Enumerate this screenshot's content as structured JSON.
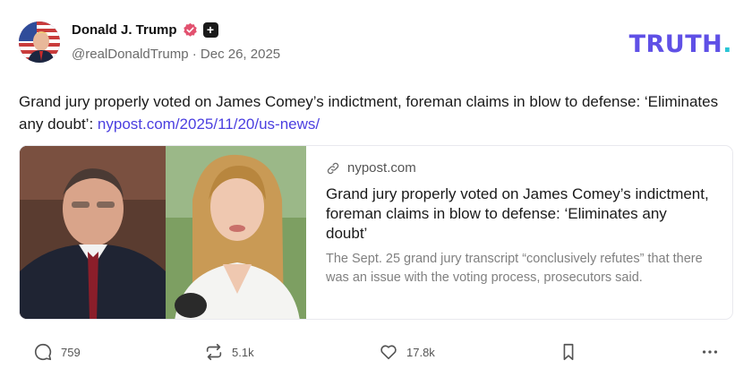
{
  "post": {
    "author": {
      "display_name": "Donald J. Trump",
      "handle": "@realDonaldTrump",
      "separator": "·",
      "date": "Dec 26, 2025",
      "verified_color": "#e2516f"
    },
    "logo": {
      "text": "TRUTH",
      "dot": ".",
      "color": "#5f50e6",
      "dot_color": "#29c5d5"
    },
    "text": "Grand jury properly voted on James Comey’s indictment, foreman claims in blow to defense: ‘Eliminates any doubt’: ",
    "link_text": "nypost.com/2025/11/20/us-news/",
    "link_color": "#4b3fe0",
    "card": {
      "domain": "nypost.com",
      "domain_icon": "link-icon",
      "title": "Grand jury properly voted on James Comey’s indictment, foreman claims in blow to defense: ‘Eliminates any doubt’",
      "description": "The Sept. 25 grand jury transcript “conclusively refutes” that there was an issue with the voting process, prosecutors said."
    },
    "actions": {
      "reply": {
        "icon": "reply-icon",
        "count": "759"
      },
      "retruth": {
        "icon": "retruth-icon",
        "count": "5.1k"
      },
      "like": {
        "icon": "heart-icon",
        "count": "17.8k"
      },
      "bookmark": {
        "icon": "bookmark-icon"
      },
      "more": {
        "icon": "more-icon"
      }
    }
  }
}
